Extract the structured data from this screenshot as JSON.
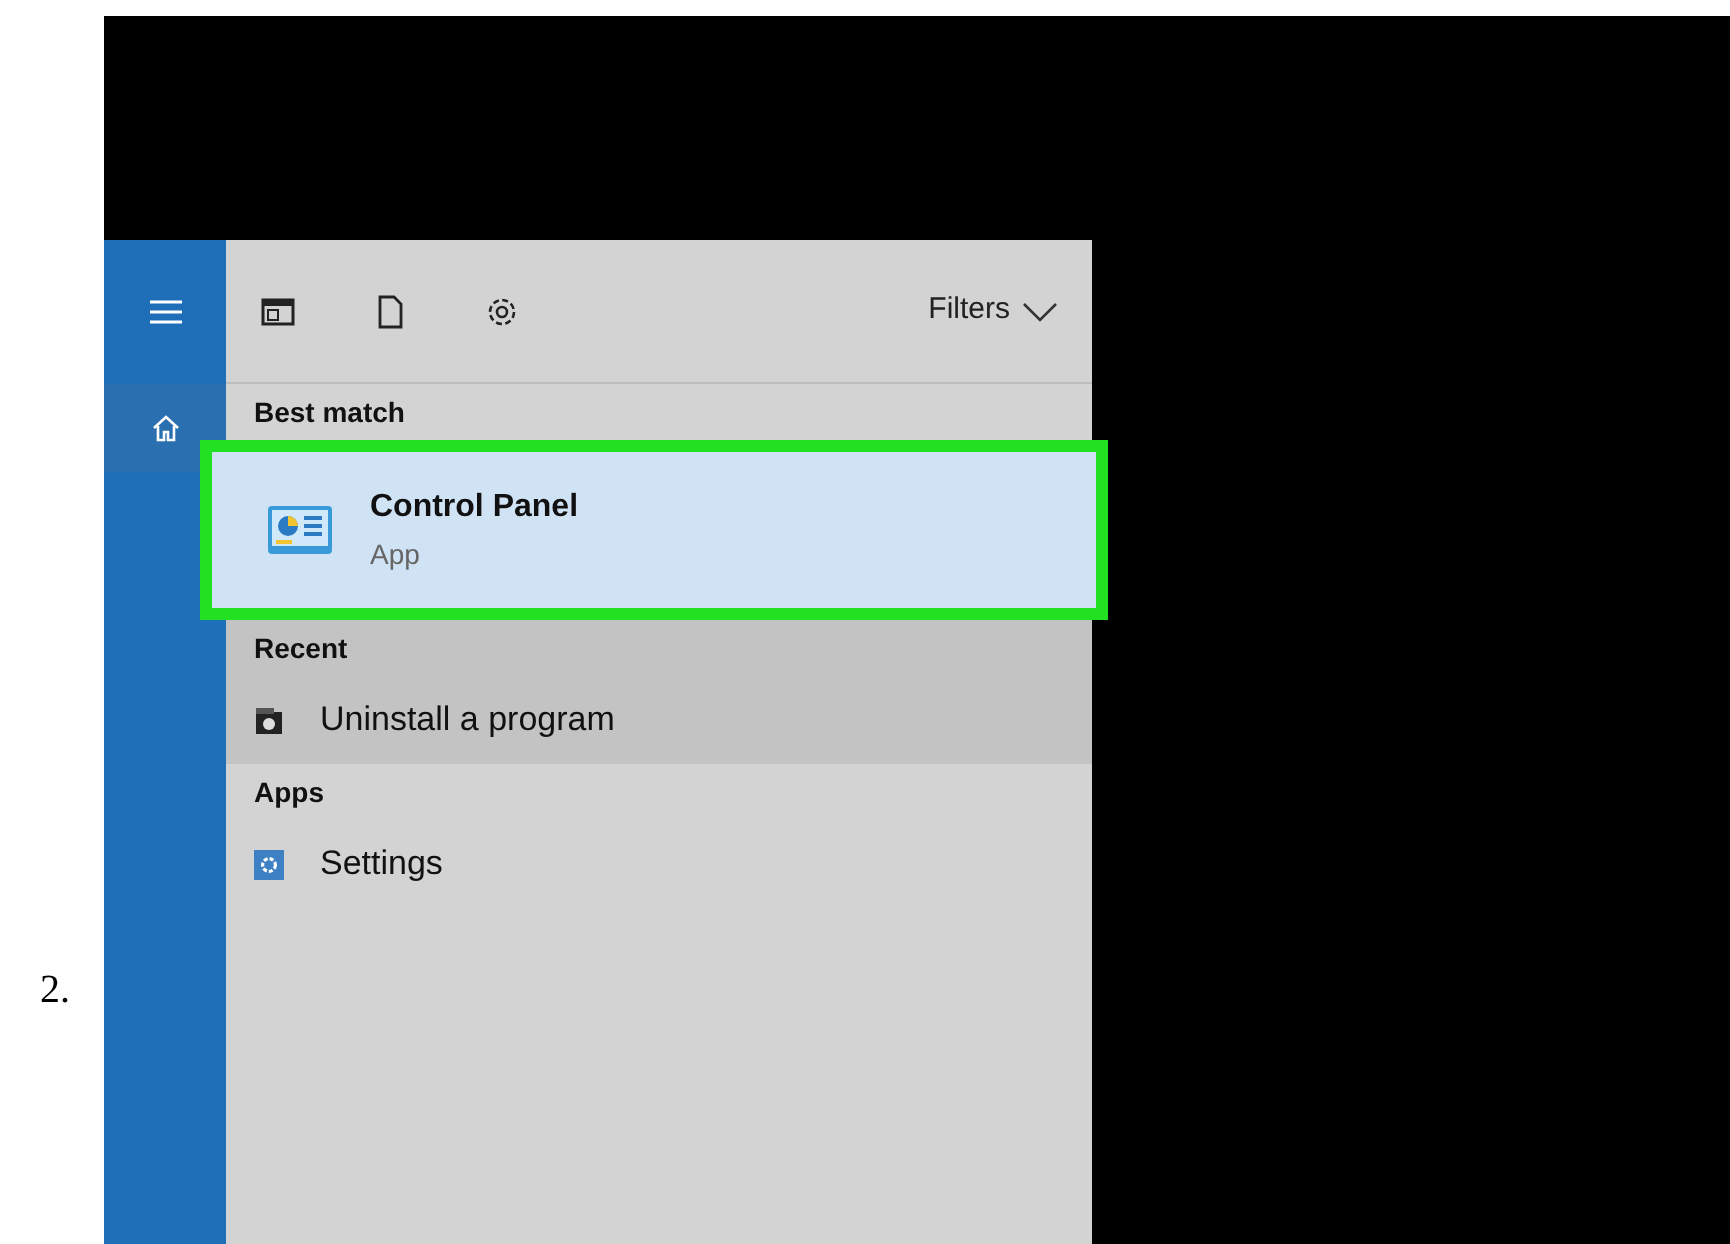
{
  "step_number": "2.",
  "rail": {
    "items": [
      {
        "kind": "menu"
      },
      {
        "kind": "home"
      }
    ]
  },
  "toolbar": {
    "icons": [
      {
        "kind": "apps"
      },
      {
        "kind": "document"
      },
      {
        "kind": "settings"
      }
    ],
    "filters": "Filters"
  },
  "sections": [
    {
      "heading": "Best match",
      "kind": "best",
      "items": [
        {
          "title": "Control Panel",
          "subtitle": "App",
          "kind": "control-panel",
          "selected": true
        }
      ]
    },
    {
      "heading": "Recent",
      "kind": "recent",
      "items": [
        {
          "title": "Uninstall a program",
          "kind": "program",
          "selected": false
        }
      ]
    },
    {
      "heading": "Apps",
      "kind": "apps",
      "items": [
        {
          "title": "Settings",
          "kind": "settings",
          "selected": false
        }
      ]
    }
  ]
}
